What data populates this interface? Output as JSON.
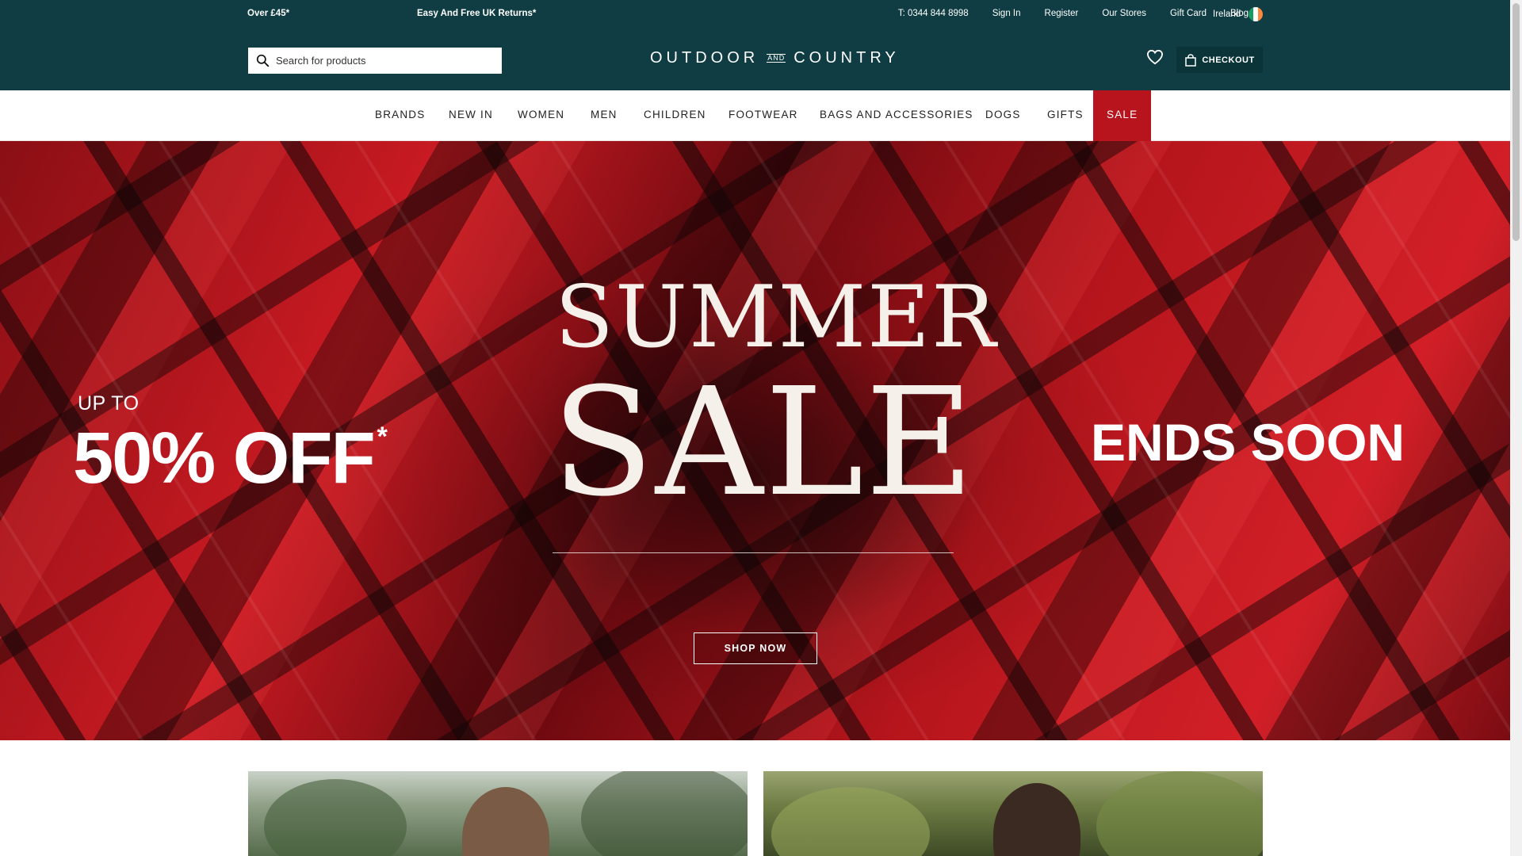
{
  "topbar": {
    "promo_1": "Over £45*",
    "promo_2": "Easy And Free UK Returns*",
    "phone": "T: 0344 844 8998",
    "sign_in": "Sign In",
    "register": "Register",
    "our_stores": "Our Stores",
    "gift_card": "Gift Card",
    "blog": "Blog",
    "region": "Ireland",
    "flag_colors": [
      "#169b62",
      "#ffffff",
      "#ff883e"
    ]
  },
  "header": {
    "search_placeholder": "Search for products",
    "logo_left": "OUTDOOR",
    "logo_and": "AND",
    "logo_right": "COUNTRY",
    "checkout_label": "CHECKOUT",
    "icons": [
      "search-icon",
      "heart-icon",
      "bag-icon"
    ]
  },
  "nav": {
    "items": [
      "BRANDS",
      "NEW IN",
      "WOMEN",
      "MEN",
      "CHILDREN",
      "FOOTWEAR",
      "BAGS AND ACCESSORIES",
      "DOGS",
      "GIFTS",
      "SALE"
    ],
    "sale_color": "#b8141d"
  },
  "hero": {
    "up_to": "UP TO",
    "discount": "50% OFF",
    "asterisk": "*",
    "summer": "SUMMER",
    "sale": "SALE",
    "ends_soon": "ENDS SOON",
    "cta": "SHOP NOW"
  },
  "theme": {
    "brand_teal": "#0f3d43",
    "sale_red": "#b8141d"
  }
}
